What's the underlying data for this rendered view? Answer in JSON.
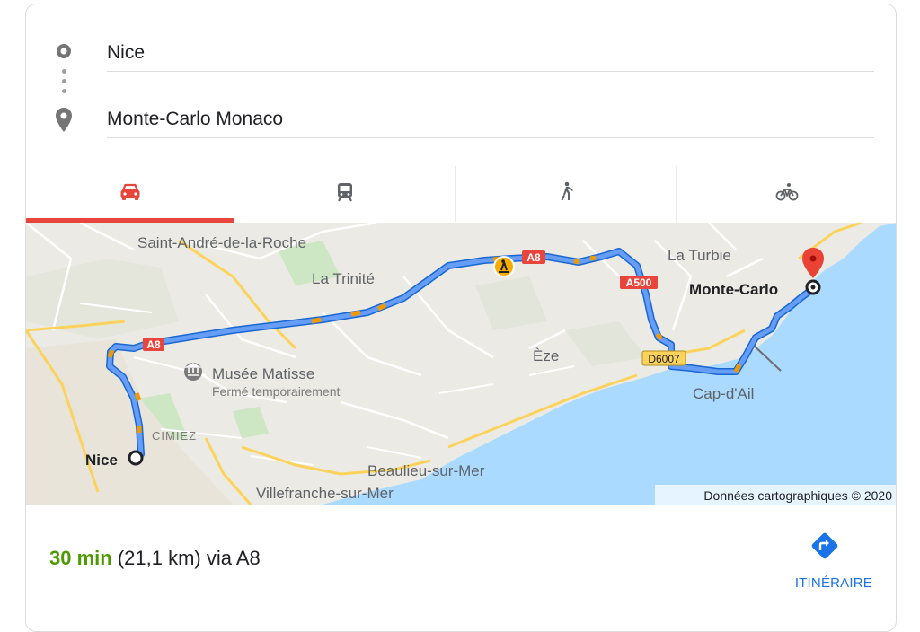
{
  "waypoints": {
    "origin": "Nice",
    "destination": "Monte-Carlo Monaco"
  },
  "tabs": [
    {
      "name": "car",
      "icon": "car-icon",
      "active": true
    },
    {
      "name": "transit",
      "icon": "transit-icon",
      "active": false
    },
    {
      "name": "walk",
      "icon": "walk-icon",
      "active": false
    },
    {
      "name": "bike",
      "icon": "bike-icon",
      "active": false
    }
  ],
  "map": {
    "places": {
      "saint_andre": "Saint-André-de-la-Roche",
      "la_trinite": "La Trinité",
      "la_turbie": "La Turbie",
      "monte_carlo": "Monte-Carlo",
      "eze": "Èze",
      "musee": "Musée Matisse",
      "musee_status": "Fermé temporairement",
      "cimiez": "CIMIEZ",
      "nice": "Nice",
      "cap_dail": "Cap-d'Ail",
      "beaulieu": "Beaulieu-sur-Mer",
      "villefranche": "Villefranche-sur-Mer"
    },
    "road_shields": {
      "a8_west": "A8",
      "a8_east": "A8",
      "a500": "A500",
      "d6007": "D6007"
    },
    "attribution": "Données cartographiques © 2020",
    "colors": {
      "route": "#4285f4",
      "traffic": "#f29900",
      "sea": "#aadaff",
      "land": "#eceae4",
      "highway": "#fbd35b",
      "pin": "#ea4335"
    }
  },
  "summary": {
    "duration": "30 min",
    "rest": " (21,1 km) via A8"
  },
  "route_button": {
    "label": "ITINÉRAIRE",
    "icon": "directions-icon"
  }
}
